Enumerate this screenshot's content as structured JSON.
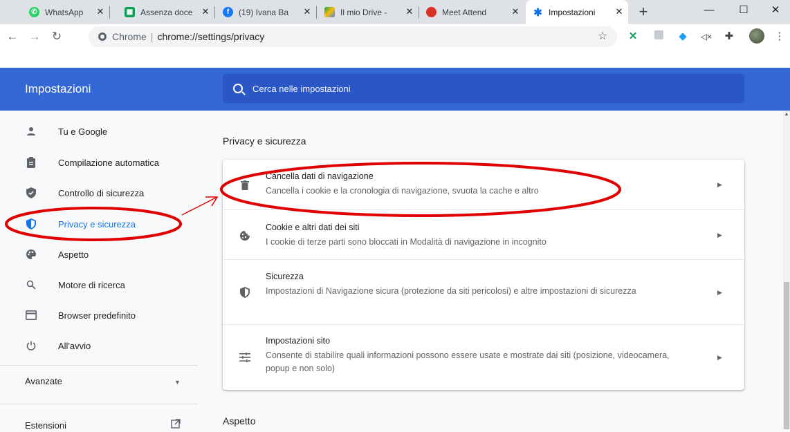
{
  "tabs": [
    {
      "label": "WhatsApp",
      "fav_color": "#25d366",
      "fav_glyph": "✆"
    },
    {
      "label": "Assenza doce",
      "fav_color": "#0f9d58",
      "fav_glyph": "▦"
    },
    {
      "label": "(19) Ivana Ba",
      "fav_color": "#1877f2",
      "fav_glyph": "f"
    },
    {
      "label": "Il mio Drive -",
      "fav_color": "#fbbc04",
      "fav_glyph": "▲"
    },
    {
      "label": "Meet Attend",
      "fav_color": "#d93025",
      "fav_glyph": "●"
    },
    {
      "label": "Impostazioni",
      "fav_color": "#1a73e8",
      "fav_glyph": "✱"
    }
  ],
  "omnibox": {
    "scheme": "Chrome",
    "url": "chrome://settings/privacy"
  },
  "header": {
    "title": "Impostazioni",
    "search_placeholder": "Cerca nelle impostazioni"
  },
  "sidebar": {
    "items": [
      {
        "label": "Tu e Google",
        "icon": "person-icon"
      },
      {
        "label": "Compilazione automatica",
        "icon": "clipboard-icon"
      },
      {
        "label": "Controllo di sicurezza",
        "icon": "shield-check-icon"
      },
      {
        "label": "Privacy e sicurezza",
        "icon": "shield-icon",
        "active": true
      },
      {
        "label": "Aspetto",
        "icon": "palette-icon"
      },
      {
        "label": "Motore di ricerca",
        "icon": "search-icon"
      },
      {
        "label": "Browser predefinito",
        "icon": "browser-icon"
      },
      {
        "label": "All'avvio",
        "icon": "power-icon"
      }
    ],
    "advanced": "Avanzate",
    "extensions": "Estensioni"
  },
  "main": {
    "section_title": "Privacy e sicurezza",
    "rows": [
      {
        "title": "Cancella dati di navigazione",
        "subtitle": "Cancella i cookie e la cronologia di navigazione, svuota la cache e altro"
      },
      {
        "title": "Cookie e altri dati dei siti",
        "subtitle": "I cookie di terze parti sono bloccati in Modalità di navigazione in incognito"
      },
      {
        "title": "Sicurezza",
        "subtitle": "Impostazioni di Navigazione sicura (protezione da siti pericolosi) e altre impostazioni di sicurezza"
      },
      {
        "title": "Impostazioni sito",
        "subtitle": "Consente di stabilire quali informazioni possono essere usate e mostrate dai siti (posizione, videocamera, popup e non solo)"
      }
    ],
    "next_section": "Aspetto"
  },
  "colors": {
    "accent": "#1a73e8",
    "header_bg": "#3367d6",
    "annotation": "#e00000"
  }
}
